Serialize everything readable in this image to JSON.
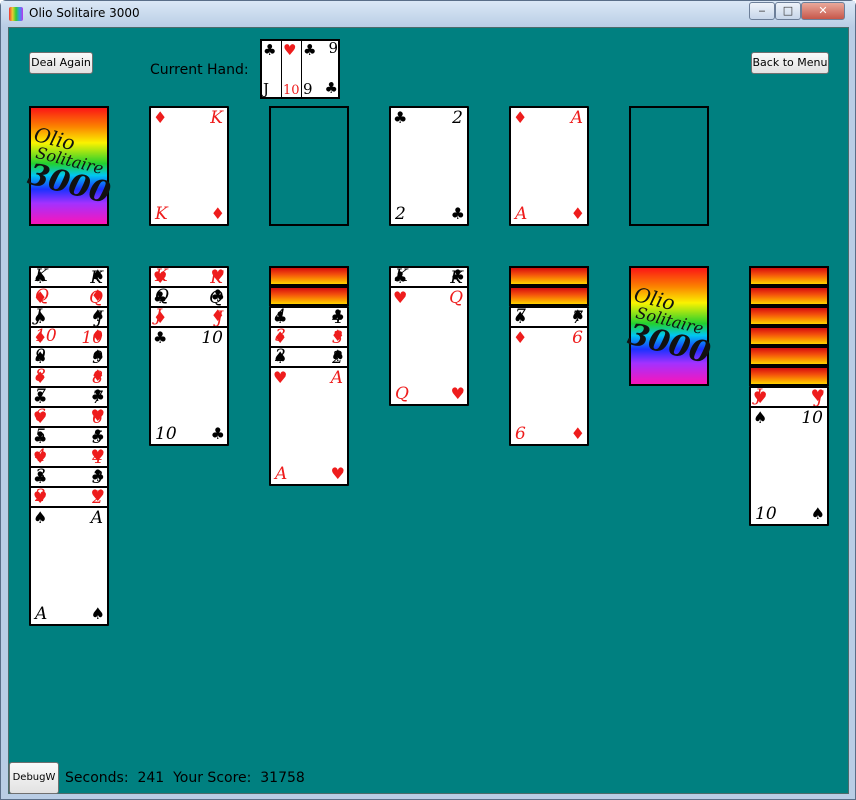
{
  "window": {
    "title": "Olio Solitaire 3000",
    "minimize": "‒",
    "maximize": "□",
    "close": "✕"
  },
  "toolbar": {
    "deal_again": "Deal Again",
    "back_to_menu": "Back to Menu",
    "current_hand_label": "Current Hand:",
    "debug": "DebugW"
  },
  "current_hand": [
    {
      "top_suit": "♣",
      "bottom_rank": "J",
      "color": "blk"
    },
    {
      "top_suit": "♥",
      "bottom_rank": "10",
      "color": "red"
    },
    {
      "top_suit": "♣",
      "top_rank": "9",
      "bottom_rank": "9",
      "bottom_suit": "♣",
      "color": "blk"
    }
  ],
  "stock": {
    "logo": {
      "l1": "Olio",
      "l2": "Solitaire",
      "l3": "3000"
    }
  },
  "foundation": [
    {
      "rank": "K",
      "suit": "♦",
      "color": "red"
    },
    null,
    {
      "rank": "2",
      "suit": "♣",
      "color": "blk"
    },
    {
      "rank": "A",
      "suit": "♦",
      "color": "red"
    },
    null
  ],
  "tableau": [
    {
      "backs": 0,
      "cards": [
        {
          "rank": "K",
          "suit": "♠",
          "color": "blk"
        },
        {
          "rank": "Q",
          "suit": "♦",
          "color": "red"
        },
        {
          "rank": "J",
          "suit": "♠",
          "color": "blk"
        },
        {
          "rank": "10",
          "suit": "♦",
          "color": "red"
        },
        {
          "rank": "9",
          "suit": "♠",
          "color": "blk"
        },
        {
          "rank": "8",
          "suit": "♦",
          "color": "red"
        },
        {
          "rank": "7",
          "suit": "♣",
          "color": "blk"
        },
        {
          "rank": "6",
          "suit": "♥",
          "color": "red"
        },
        {
          "rank": "5",
          "suit": "♣",
          "color": "blk"
        },
        {
          "rank": "4",
          "suit": "♥",
          "color": "red"
        },
        {
          "rank": "3",
          "suit": "♣",
          "color": "blk"
        },
        {
          "rank": "2",
          "suit": "♥",
          "color": "red"
        },
        {
          "rank": "A",
          "suit": "♠",
          "color": "blk"
        }
      ]
    },
    {
      "backs": 0,
      "cards": [
        {
          "rank": "K",
          "suit": "♥",
          "color": "red"
        },
        {
          "rank": "Q",
          "suit": "♣",
          "color": "blk"
        },
        {
          "rank": "J",
          "suit": "♦",
          "color": "red"
        },
        {
          "rank": "10",
          "suit": "♣",
          "color": "blk"
        }
      ]
    },
    {
      "backs": 2,
      "cards": [
        {
          "rank": "4",
          "suit": "♣",
          "color": "blk"
        },
        {
          "rank": "3",
          "suit": "♦",
          "color": "red"
        },
        {
          "rank": "2",
          "suit": "♠",
          "color": "blk"
        },
        {
          "rank": "A",
          "suit": "♥",
          "color": "red"
        }
      ]
    },
    {
      "backs": 0,
      "cards": [
        {
          "rank": "K",
          "suit": "♣",
          "color": "blk"
        },
        {
          "rank": "Q",
          "suit": "♥",
          "color": "red"
        }
      ]
    },
    {
      "backs": 2,
      "cards": [
        {
          "rank": "7",
          "suit": "♠",
          "color": "blk"
        },
        {
          "rank": "6",
          "suit": "♦",
          "color": "red"
        }
      ]
    },
    {
      "backs": 1,
      "full_back": true,
      "cards": []
    },
    {
      "backs": 6,
      "cards": [
        {
          "rank": "J",
          "suit": "♥",
          "color": "red"
        },
        {
          "rank": "10",
          "suit": "♠",
          "color": "blk"
        }
      ]
    }
  ],
  "status": {
    "seconds_label": "Seconds:",
    "seconds": "241",
    "score_label": "Your Score:",
    "score": "31758"
  }
}
